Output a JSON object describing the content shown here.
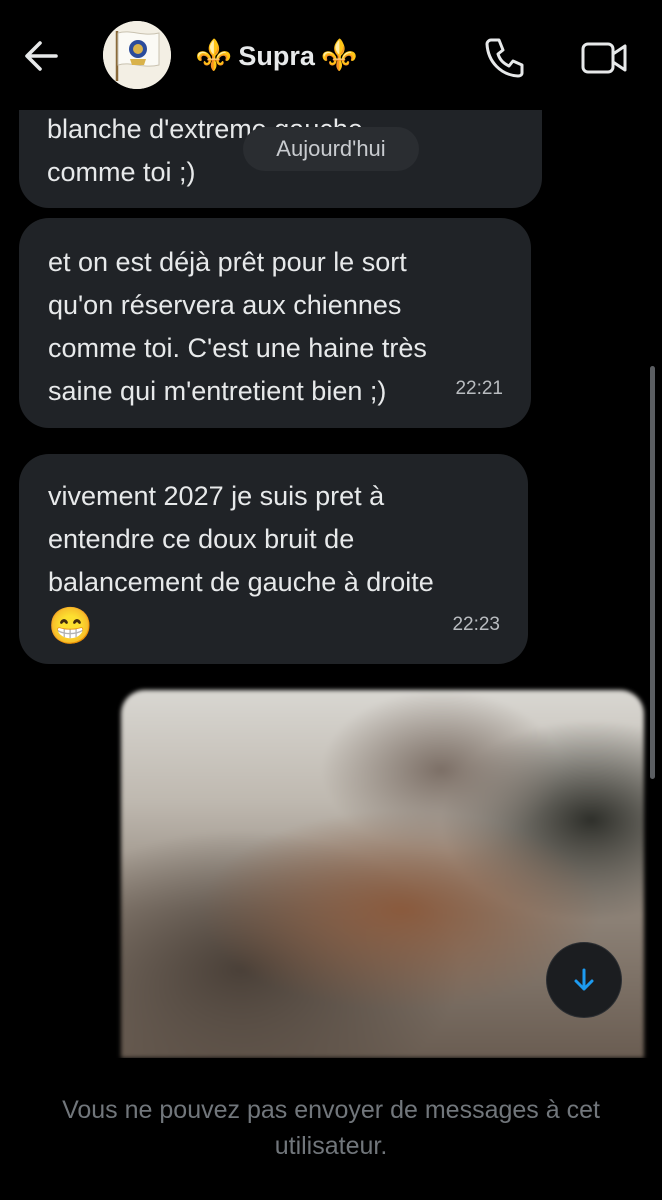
{
  "header": {
    "back_icon": "arrow-left-icon",
    "avatar_icon": "royal-flag-avatar",
    "fleur_left": "⚜️",
    "name": "Supra",
    "fleur_right": "⚜️",
    "call_icon": "phone-icon",
    "video_icon": "video-camera-icon"
  },
  "date_separator": "Aujourd'hui",
  "messages": [
    {
      "text": "blanche d'extreme gauche\ncomme toi ;)",
      "time": ""
    },
    {
      "text": "et on est déjà prêt pour le sort\nqu'on réservera aux chiennes\ncomme toi. C'est une haine très\nsaine qui m'entretient bien ;)",
      "time": "22:21"
    },
    {
      "text": "vivement 2027 je suis pret à\nentendre ce doux bruit de\nbalancement de gauche à droite",
      "emoji": "😁",
      "time": "22:23"
    }
  ],
  "image_message": {
    "type": "photo",
    "description_visible": false
  },
  "scroll_button_icon": "arrow-down-icon",
  "footer": {
    "notice": "Vous ne pouvez pas envoyer de messages à cet utilisateur."
  },
  "colors": {
    "background": "#000000",
    "bubble": "#202327",
    "accent": "#1d9bf0",
    "muted_text": "#71767b"
  }
}
